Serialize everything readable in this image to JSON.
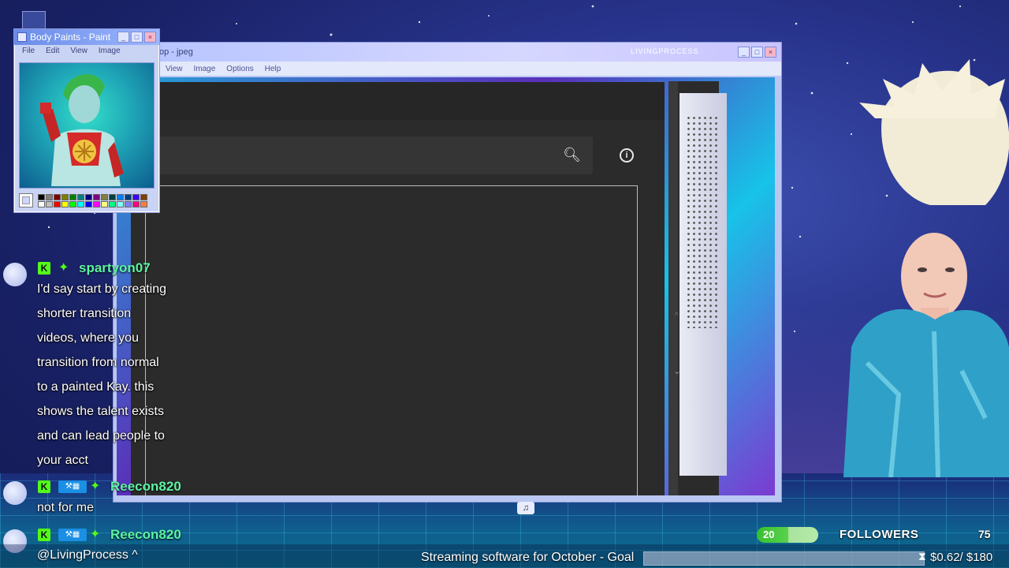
{
  "paint_window": {
    "title": "Body Paints - Paint",
    "menu": [
      "File",
      "Edit",
      "View",
      "Image"
    ],
    "palette_colors": [
      "#000000",
      "#808080",
      "#800000",
      "#808000",
      "#008000",
      "#008080",
      "#000080",
      "#800080",
      "#808040",
      "#004040",
      "#0080ff",
      "#004080",
      "#4000ff",
      "#804000",
      "#ffffff",
      "#c0c0c0",
      "#ff0000",
      "#ffff00",
      "#00ff00",
      "#00ffff",
      "#0000ff",
      "#ff00ff",
      "#ffff80",
      "#00ff80",
      "#80ffff",
      "#8080ff",
      "#ff0080",
      "#ff8040"
    ]
  },
  "main_window": {
    "title": "op - jpeg",
    "brand": "LIVINGPROCESS",
    "menu": [
      "View",
      "Image",
      "Options",
      "Help"
    ]
  },
  "chat": {
    "messages": [
      {
        "username": "spartyon07",
        "lines": [
          "I'd say start by creating",
          "shorter transition",
          "videos, where you",
          "transition from normal",
          "to a painted Kay. this",
          "shows the talent exists",
          "and can lead people to",
          "your acct"
        ]
      },
      {
        "username": "Reecon820",
        "lines": [
          "not for me"
        ]
      },
      {
        "username": "Reecon820",
        "lines": [
          "@LivingProcess ^"
        ]
      }
    ]
  },
  "goal": {
    "text": "Streaming software for October - Goal",
    "amount": "$0.62/ $180",
    "progress": 0.003
  },
  "followers": {
    "count": "20",
    "label": "FOLLOWERS",
    "goal": "75",
    "progress": 0.27
  },
  "colors": {
    "accent_green": "#53fc18",
    "username_green": "#5df4a3",
    "dark_app_bg": "#2b2b2b"
  }
}
